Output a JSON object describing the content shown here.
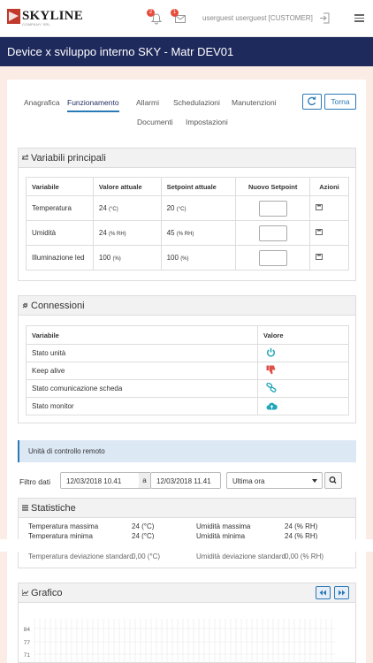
{
  "app": {
    "logo_text": "SKYLINE",
    "logo_sub": "COMPANY SRL",
    "user": "userguest userguest [CUSTOMER]",
    "notifications": {
      "bell_count": "2",
      "mail_count": "1"
    }
  },
  "page": {
    "title": "Device x sviluppo interno SKY - Matr DEV01"
  },
  "tabs": [
    {
      "label": "Anagrafica",
      "active": false
    },
    {
      "label": "Funzionamento",
      "active": true
    },
    {
      "label": "Allarmi",
      "active": false
    },
    {
      "label": "Schedulazioni",
      "active": false
    },
    {
      "label": "Manutenzioni",
      "active": false
    },
    {
      "label": "Documenti",
      "active": false
    },
    {
      "label": "Impostazioni",
      "active": false
    }
  ],
  "toolbar": {
    "back_label": "Torna"
  },
  "main_vars": {
    "title": "Variabili principali",
    "headers": [
      "Variabile",
      "Valore attuale",
      "Setpoint attuale",
      "Nuovo Setpoint",
      "Azioni"
    ],
    "rows": [
      {
        "name": "Temperatura",
        "value": "24",
        "value_unit": "(°C)",
        "setpoint": "20",
        "setpoint_unit": "(°C)"
      },
      {
        "name": "Umidità",
        "value": "24",
        "value_unit": "(% RH)",
        "setpoint": "45",
        "setpoint_unit": "(% RH)"
      },
      {
        "name": "Illuminazione led",
        "value": "100",
        "value_unit": "(%)",
        "setpoint": "100",
        "setpoint_unit": "(%)"
      }
    ]
  },
  "connections": {
    "title": "Connessioni",
    "headers": [
      "Variabile",
      "Valore"
    ],
    "rows": [
      {
        "name": "Stato unità",
        "icon": "power-icon"
      },
      {
        "name": "Keep alive",
        "icon": "thumbs-down-icon"
      },
      {
        "name": "Stato comunicazione scheda",
        "icon": "link-icon"
      },
      {
        "name": "Stato monitor",
        "icon": "cloud-upload-icon"
      }
    ]
  },
  "remote": {
    "label": "Unità di controllo remoto"
  },
  "filter": {
    "label": "Filtro dati",
    "from": "12/03/2018 10.41",
    "separator": "a",
    "to": "12/03/2018 11.41",
    "range": "Ultima ora"
  },
  "stats": {
    "title": "Statistiche",
    "rows": [
      {
        "label": "Temperatura massima",
        "value": "24 (°C)",
        "label2": "Umidità massima",
        "value2": "24 (% RH)"
      },
      {
        "label": "Temperatura minima",
        "value": "24 (°C)",
        "label2": "Umidità minima",
        "value2": "24 (% RH)"
      },
      {
        "label": "Temperatura deviazione standard",
        "value": "0,00 (°C)",
        "label2": "Umidità deviazione standard",
        "value2": "0,00 (% RH)"
      }
    ]
  },
  "graph": {
    "title": "Grafico",
    "y_ticks": [
      "84",
      "77",
      "71"
    ]
  },
  "colors": {
    "nav": "#1f2a5c",
    "accent": "#2a7ab8",
    "ok": "#1fa6b8",
    "bad": "#e0504a"
  }
}
